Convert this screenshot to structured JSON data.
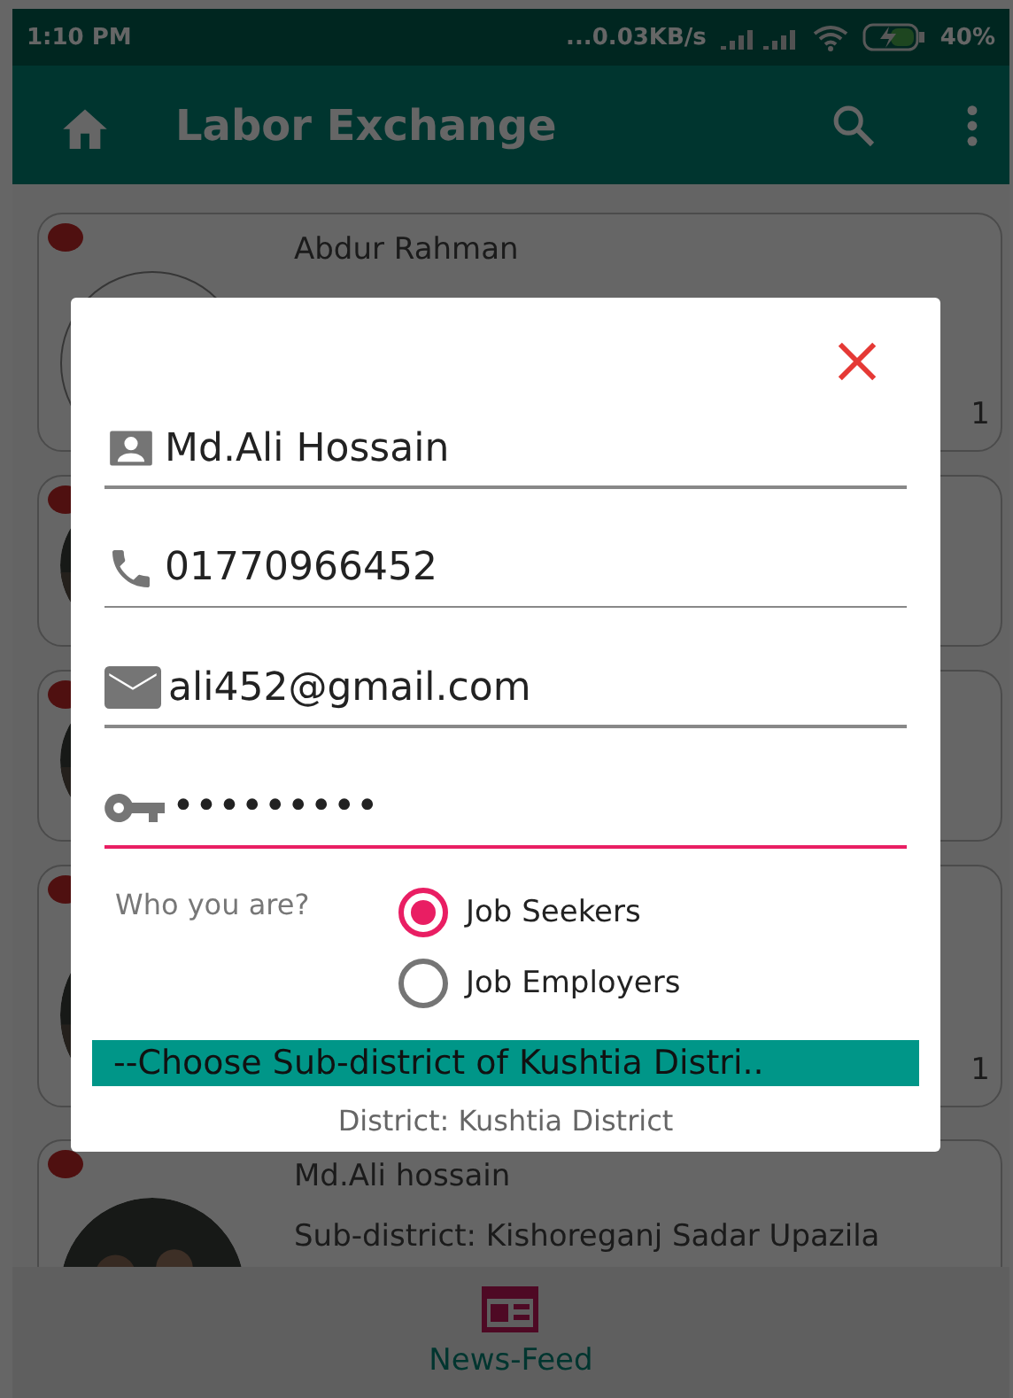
{
  "status_bar": {
    "time": "1:10 PM",
    "network_speed": "...0.03KB/s",
    "battery": "40%"
  },
  "app_bar": {
    "title": "Labor Exchange"
  },
  "cards": [
    {
      "name": "Abdur Rahman",
      "kind": "placeholder",
      "count": "1"
    },
    {
      "kind": "picture"
    },
    {
      "kind": "picture"
    },
    {
      "kind": "picture",
      "count": "1"
    },
    {
      "name": "Md.Ali hossain",
      "subdistrict": "Sub-district: Kishoreganj Sadar Upazila",
      "kind": "picture"
    }
  ],
  "dialog": {
    "fields": [
      {
        "kind": "person",
        "value": "Md.Ali Hossain",
        "focused": false
      },
      {
        "kind": "phone",
        "value": "01770966452",
        "focused": false
      },
      {
        "kind": "email",
        "value": "ali452@gmail.com",
        "focused": false
      },
      {
        "kind": "key",
        "value": "•••••••••",
        "focused": true
      }
    ],
    "role_label": "Who you are?",
    "roles": [
      {
        "label": "Job Seekers",
        "selected": true
      },
      {
        "label": "Job Employers",
        "selected": false
      }
    ],
    "subdistrict_spinner": "--Choose Sub-district of Kushtia Distri..",
    "district": "District: Kushtia District"
  },
  "bottom_nav": [
    {
      "label": "News-Feed",
      "selected": true
    }
  ]
}
